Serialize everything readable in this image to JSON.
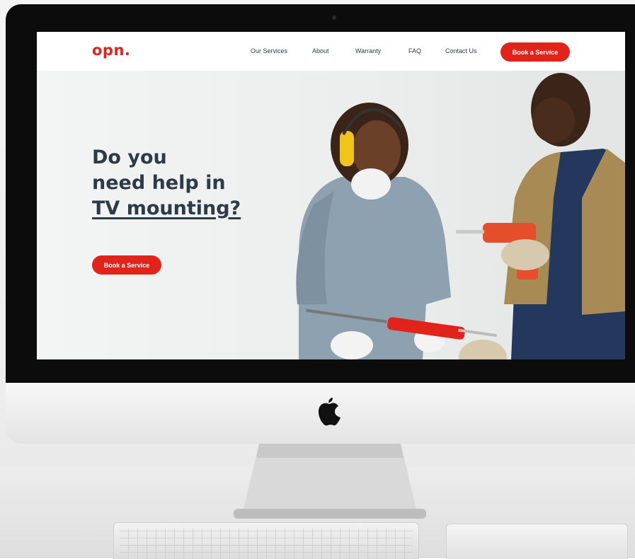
{
  "site": {
    "logo": "opn.",
    "nav": {
      "links": [
        "Our Services",
        "About",
        "Warranty",
        "FAQ",
        "Contact Us"
      ],
      "cta": "Book a Service"
    },
    "hero": {
      "title_lines": [
        "Do you",
        "need help in",
        "TV mounting?"
      ],
      "cta": "Book a Service"
    }
  },
  "colors": {
    "accent": "#e2231a",
    "heading": "#2d3a48"
  },
  "icons": {
    "apple_logo": "apple-logo-icon"
  }
}
